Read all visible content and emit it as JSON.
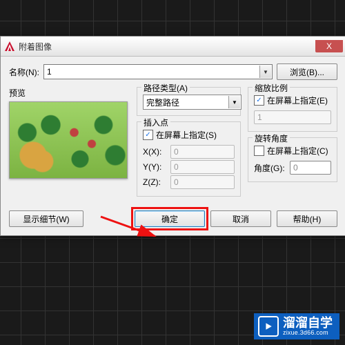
{
  "dialog": {
    "title": "附着图像",
    "close_icon": "X"
  },
  "nameRow": {
    "label": "名称(N):",
    "value": "1",
    "browse": "浏览(B)..."
  },
  "preview": {
    "label": "预览"
  },
  "pathType": {
    "legend": "路径类型(A)",
    "selected": "完整路径"
  },
  "insertPoint": {
    "legend": "插入点",
    "specOnScreen": "在屏幕上指定(S)",
    "x_label": "X(X):",
    "x_val": "0",
    "y_label": "Y(Y):",
    "y_val": "0",
    "z_label": "Z(Z):",
    "z_val": "0"
  },
  "scale": {
    "legend": "缩放比例",
    "specOnScreen": "在屏幕上指定(E)",
    "one_val": "1"
  },
  "rotation": {
    "legend": "旋转角度",
    "specOnScreen": "在屏幕上指定(C)",
    "angle_label": "角度(G):",
    "angle_val": "0"
  },
  "buttons": {
    "details": "显示细节(W)",
    "ok": "确定",
    "cancel": "取消",
    "help": "帮助(H)"
  },
  "watermark": {
    "brand": "溜溜自学",
    "url": "zixue.3d66.com"
  }
}
